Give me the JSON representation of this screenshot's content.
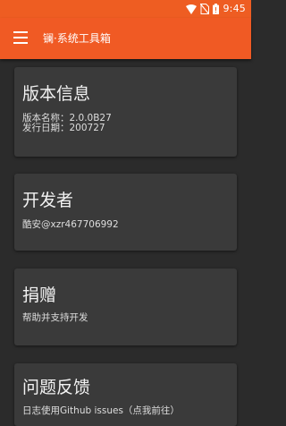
{
  "status_bar": {
    "time": "9:45",
    "icons": [
      "wifi-icon",
      "no-sim-icon",
      "battery-icon"
    ]
  },
  "app_bar": {
    "title": "镧·系统工具箱",
    "menu_icon": "menu-icon"
  },
  "cards": {
    "version": {
      "title": "版本信息",
      "line1": "版本名称：2.0.0B27",
      "line2": "发行日期：200727"
    },
    "developer": {
      "title": "开发者",
      "line1": "酷安@xzr467706992"
    },
    "donate": {
      "title": "捐赠",
      "line1": "帮助并支持开发"
    },
    "feedback": {
      "title": "问题反馈",
      "line1": "日志使用Github issues（点我前往）"
    }
  },
  "colors": {
    "accent": "#f05a24",
    "background": "#2b2b2b",
    "card": "#3a3a3a",
    "text": "#f2f2f2"
  }
}
